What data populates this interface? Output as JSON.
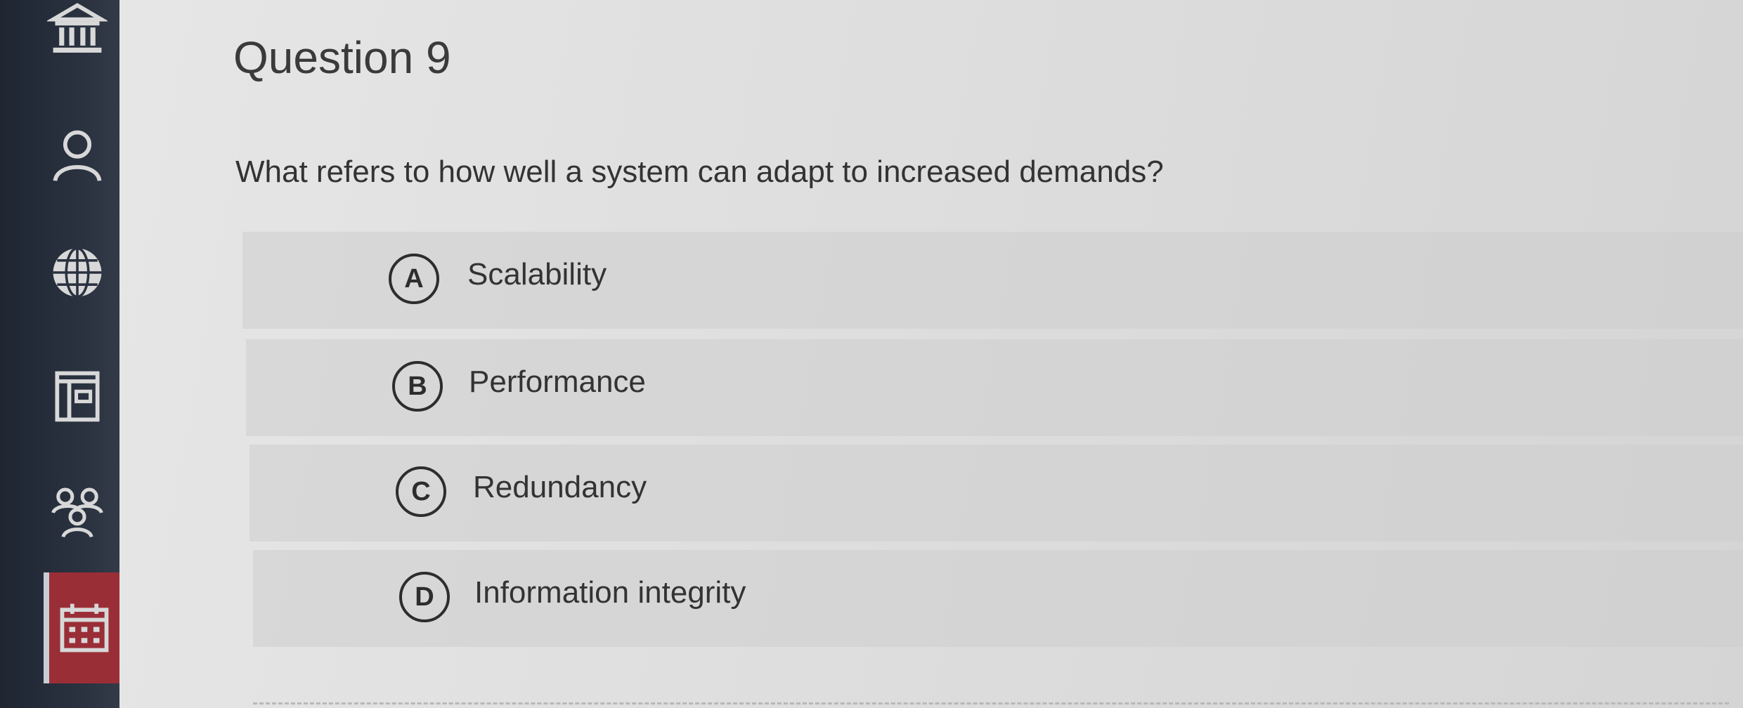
{
  "sidebar": {
    "items": [
      {
        "icon": "institution-icon"
      },
      {
        "icon": "account-icon"
      },
      {
        "icon": "globe-icon"
      },
      {
        "icon": "dashboard-icon"
      },
      {
        "icon": "groups-icon"
      },
      {
        "icon": "calendar-icon",
        "active": true
      }
    ]
  },
  "question": {
    "title": "Question 9",
    "text": "What refers to how well a system can adapt to increased demands?"
  },
  "options": [
    {
      "letter": "A",
      "label": "Scalability"
    },
    {
      "letter": "B",
      "label": "Performance"
    },
    {
      "letter": "C",
      "label": "Redundancy"
    },
    {
      "letter": "D",
      "label": "Information integrity"
    }
  ],
  "colors": {
    "sidebar": "#2a3240",
    "active_nav": "#9a2e37",
    "background": "#dedede"
  }
}
